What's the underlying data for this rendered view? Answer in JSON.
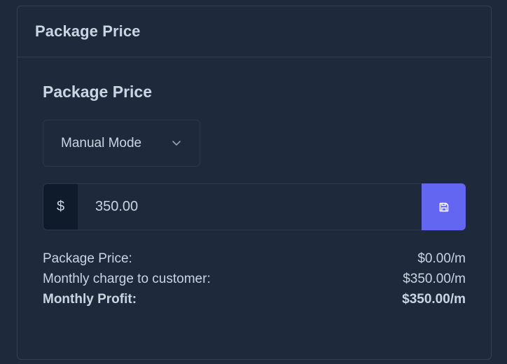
{
  "card": {
    "title": "Package Price"
  },
  "section": {
    "title": "Package Price"
  },
  "mode_select": {
    "value": "Manual Mode",
    "icon": "chevron-down-icon"
  },
  "price": {
    "currency_symbol": "$",
    "value": "350.00",
    "save_icon": "save-icon"
  },
  "summary": {
    "rows": [
      {
        "label": "Package Price:",
        "value": "$0.00/m"
      },
      {
        "label": "Monthly charge to customer:",
        "value": "$350.00/m"
      },
      {
        "label": "Monthly Profit:",
        "value": "$350.00/m"
      }
    ]
  },
  "colors": {
    "background": "#1e293b",
    "border": "#334155",
    "accent": "#6366f1",
    "text": "#cbd5e1"
  }
}
